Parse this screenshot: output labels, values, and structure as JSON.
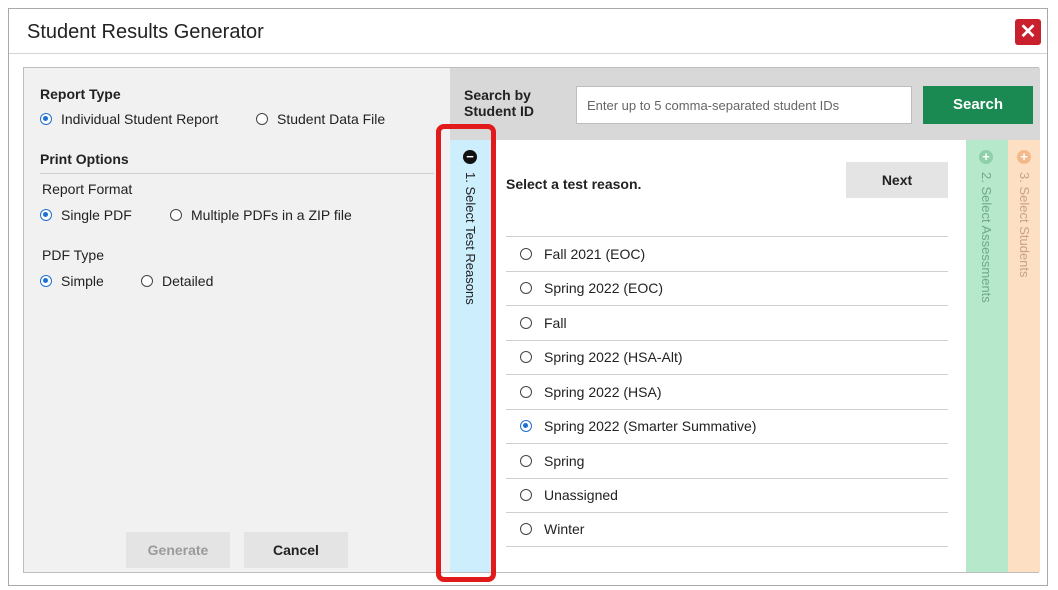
{
  "dialog": {
    "title": "Student Results Generator",
    "close_icon": "close-icon",
    "close_color": "#c8202c"
  },
  "left": {
    "report_type_title": "Report Type",
    "report_type_options": [
      {
        "label": "Individual Student Report",
        "checked": true
      },
      {
        "label": "Student Data File",
        "checked": false
      }
    ],
    "print_options_title": "Print Options",
    "report_format_label": "Report Format",
    "report_format_options": [
      {
        "label": "Single PDF",
        "checked": true
      },
      {
        "label": "Multiple PDFs in a ZIP file",
        "checked": false
      }
    ],
    "pdf_type_label": "PDF Type",
    "pdf_type_options": [
      {
        "label": "Simple",
        "checked": true
      },
      {
        "label": "Detailed",
        "checked": false
      }
    ],
    "generate_label": "Generate",
    "cancel_label": "Cancel"
  },
  "search": {
    "label": "Search by Student ID",
    "placeholder": "Enter up to 5 comma-separated student IDs",
    "value": "",
    "button_label": "Search",
    "button_color": "#1b8a52"
  },
  "steps": [
    {
      "label": "1. Select Test Reasons",
      "icon": "minus-circle-icon",
      "color": "#cdeefc"
    },
    {
      "label": "2. Select Assessments",
      "icon": "plus-circle-icon",
      "color": "#b6e8cc"
    },
    {
      "label": "3. Select Students",
      "icon": "plus-circle-icon",
      "color": "#fddfc4"
    }
  ],
  "reasons": {
    "title": "Select a test reason.",
    "next_label": "Next",
    "items": [
      {
        "label": "Fall 2021 (EOC)",
        "checked": false
      },
      {
        "label": "Spring 2022 (EOC)",
        "checked": false
      },
      {
        "label": "Fall",
        "checked": false
      },
      {
        "label": "Spring 2022 (HSA-Alt)",
        "checked": false
      },
      {
        "label": "Spring 2022 (HSA)",
        "checked": false
      },
      {
        "label": "Spring 2022 (Smarter Summative)",
        "checked": true
      },
      {
        "label": "Spring",
        "checked": false
      },
      {
        "label": "Unassigned",
        "checked": false
      },
      {
        "label": "Winter",
        "checked": false
      }
    ]
  }
}
